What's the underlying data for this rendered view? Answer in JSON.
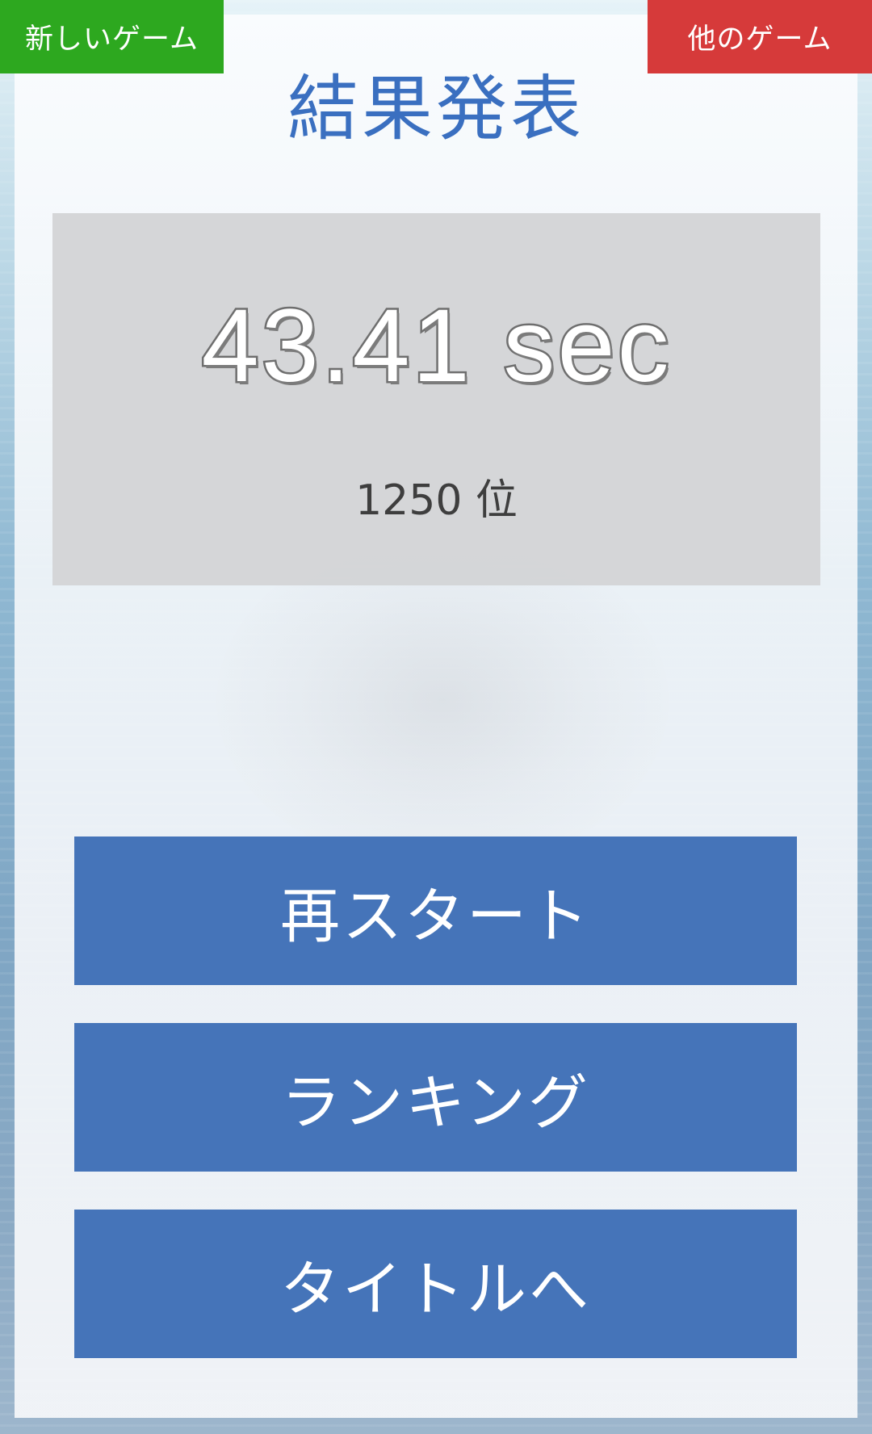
{
  "header": {
    "new_game_label": "新しいゲーム",
    "other_games_label": "他のゲーム"
  },
  "title": "結果発表",
  "result": {
    "time": "43.41 sec",
    "rank": "1250 位"
  },
  "buttons": {
    "restart": "再スタート",
    "ranking": "ランキング",
    "to_title": "タイトルへ"
  },
  "colors": {
    "new_game_bg": "#2da81f",
    "other_games_bg": "#d63a3a",
    "title_color": "#3a6fc0",
    "button_bg": "#4574b9",
    "result_box_bg": "#d3d4d6"
  }
}
